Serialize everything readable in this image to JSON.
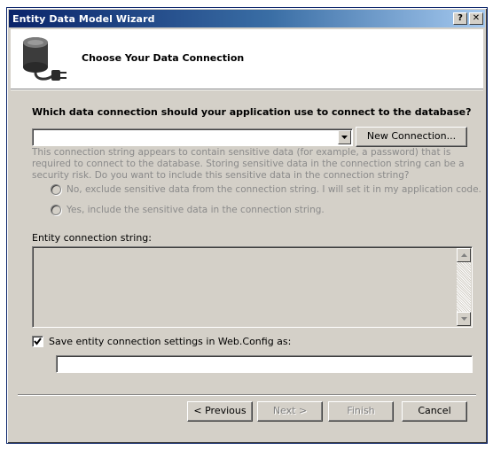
{
  "window": {
    "title": "Entity Data Model Wizard",
    "help_glyph": "?",
    "close_glyph": "✕"
  },
  "header": {
    "title": "Choose Your Data Connection",
    "icon": "database-plug-icon"
  },
  "connection": {
    "question": "Which data connection should your application use to connect to the database?",
    "selected_value": "",
    "new_connection_label": "New Connection..."
  },
  "sensitive": {
    "warning": "This connection string appears to contain sensitive data (for example, a password) that is required to connect to the database. Storing sensitive data in the connection string can be a security risk. Do you want to include this sensitive data in the connection string?",
    "option_no": "No, exclude sensitive data from the connection string. I will set it in my application code.",
    "option_yes": "Yes, include the sensitive data in the connection string."
  },
  "entity_connection": {
    "label": "Entity connection string:",
    "value": ""
  },
  "save_settings": {
    "label": "Save entity connection settings in Web.Config as:",
    "checked": true,
    "value": ""
  },
  "buttons": {
    "previous": "< Previous",
    "next": "Next >",
    "finish": "Finish",
    "cancel": "Cancel"
  },
  "colors": {
    "title_bar_start": "#0a246a",
    "title_bar_end": "#a6caf0",
    "dialog_face": "#d4d0c8",
    "disabled_text": "#8a8a8a"
  }
}
